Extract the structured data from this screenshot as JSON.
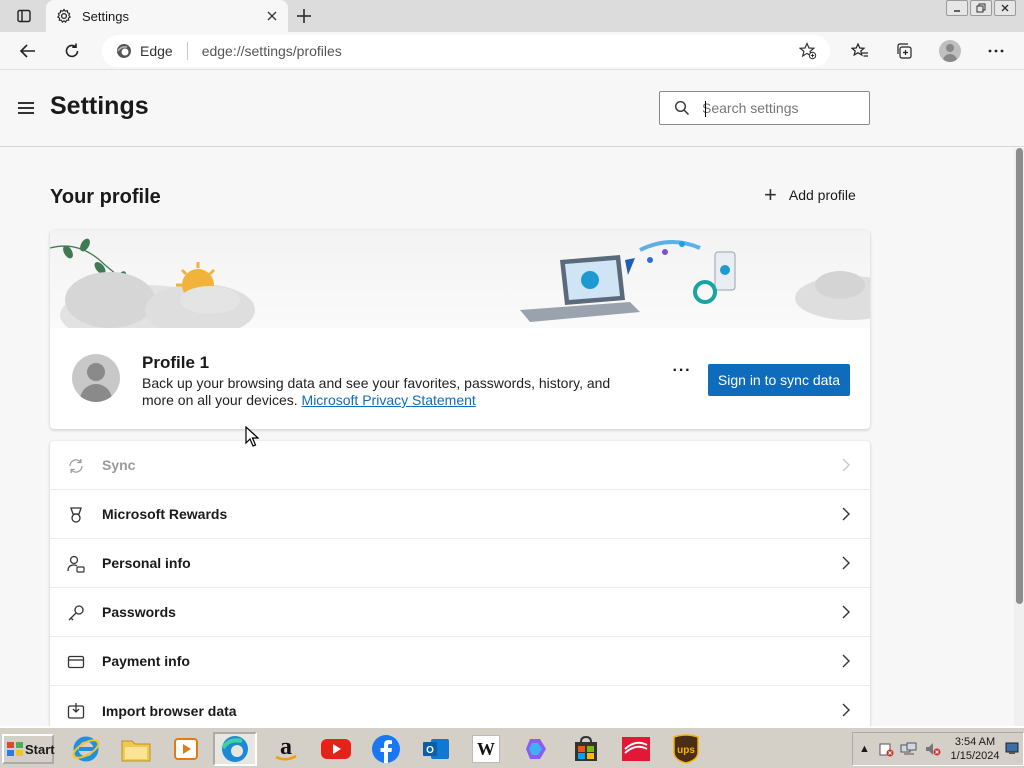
{
  "browser": {
    "tab_title": "Settings",
    "omnibox_label": "Edge",
    "url": "edge://settings/profiles"
  },
  "header": {
    "title": "Settings",
    "search_placeholder": "Search settings"
  },
  "profile": {
    "heading": "Your profile",
    "add_profile_label": "Add profile",
    "name": "Profile 1",
    "description": "Back up your browsing data and see your favorites, passwords, history, and more on all your devices.",
    "privacy_link": "Microsoft Privacy Statement",
    "sync_button": "Sign in to sync data",
    "more_label": "···"
  },
  "menu": {
    "items": [
      {
        "label": "Sync",
        "icon": "sync-icon",
        "disabled": true
      },
      {
        "label": "Microsoft Rewards",
        "icon": "rewards-icon"
      },
      {
        "label": "Personal info",
        "icon": "personal-info-icon"
      },
      {
        "label": "Passwords",
        "icon": "key-icon"
      },
      {
        "label": "Payment info",
        "icon": "credit-card-icon"
      },
      {
        "label": "Import browser data",
        "icon": "import-icon"
      }
    ]
  },
  "taskbar": {
    "start_label": "Start",
    "time": "3:54 AM",
    "date": "1/15/2024",
    "wiki_glyph": "W"
  },
  "colors": {
    "accent": "#0f6cbd",
    "taskbar": "#d4d0c8"
  }
}
